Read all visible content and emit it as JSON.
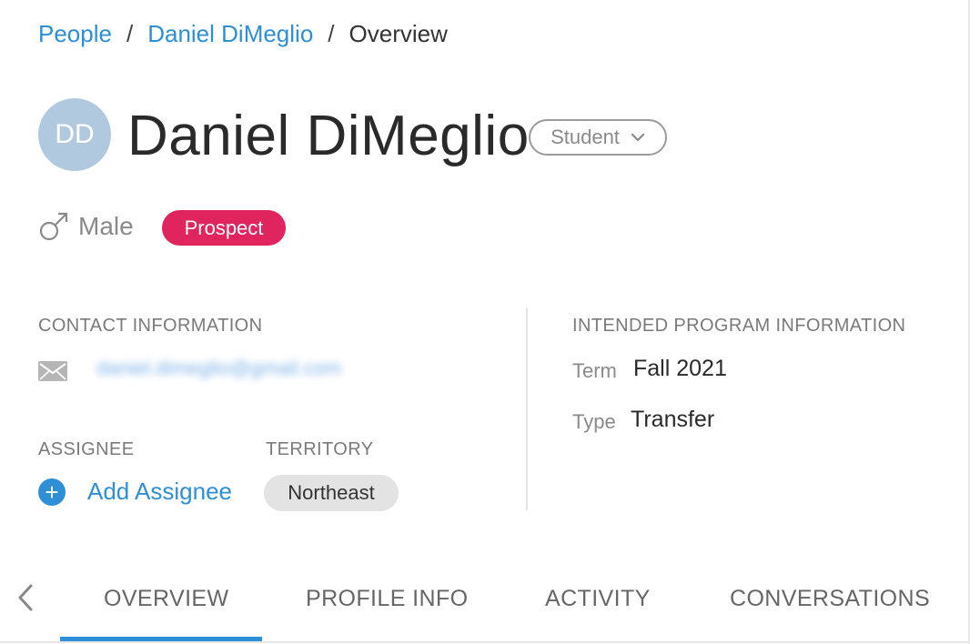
{
  "breadcrumb": {
    "items": [
      {
        "label": "People"
      },
      {
        "label": "Daniel DiMeglio"
      }
    ],
    "separator": "/",
    "current": "Overview"
  },
  "profile": {
    "initials": "DD",
    "name": "Daniel DiMeglio",
    "role": "Student",
    "gender": "Male",
    "status_badge": "Prospect"
  },
  "contact": {
    "title": "CONTACT INFORMATION",
    "email": "daniel.dimeglio@gmail.com"
  },
  "assignee": {
    "title": "ASSIGNEE",
    "add_label": "Add Assignee"
  },
  "territory": {
    "title": "TERRITORY",
    "value": "Northeast"
  },
  "program": {
    "title": "INTENDED PROGRAM INFORMATION",
    "term_label": "Term",
    "term_value": "Fall 2021",
    "type_label": "Type",
    "type_value": "Transfer"
  },
  "tabs": [
    {
      "label": "OVERVIEW"
    },
    {
      "label": "PROFILE INFO"
    },
    {
      "label": "ACTIVITY"
    },
    {
      "label": "CONVERSATIONS"
    }
  ],
  "colors": {
    "link": "#2e8fd6",
    "badge": "#e0245e",
    "avatar": "#b1c9df",
    "chip": "#e3e3e3"
  },
  "icons": [
    "male-icon",
    "chevron-down-icon",
    "envelope-icon",
    "plus-icon",
    "chevron-left-icon"
  ]
}
